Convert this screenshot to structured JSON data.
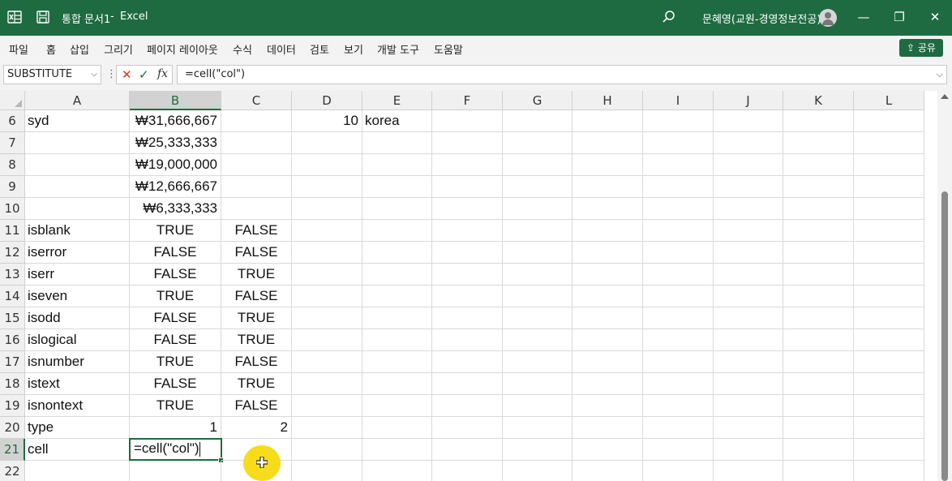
{
  "titlebar": {
    "filename": "통합 문서1",
    "separator": "-",
    "app": "Excel",
    "user": "문혜영(교원-경영정보전공)",
    "icons": [
      "excel-logo-icon",
      "save-icon",
      "search-icon",
      "avatar",
      "minimize-icon",
      "restore-icon",
      "close-icon"
    ],
    "colors": {
      "bar": "#1e6b41",
      "text": "#ffffff"
    }
  },
  "menu": {
    "items": [
      "파일",
      "홈",
      "삽입",
      "그리기",
      "페이지 레이아웃",
      "수식",
      "데이터",
      "검토",
      "보기",
      "개발 도구",
      "도움말"
    ],
    "share_label": "공유"
  },
  "formula_bar": {
    "name_box": "SUBSTITUTE",
    "separator": "⋮",
    "cancel_icon": "✕",
    "enter_icon": "✓",
    "fx_label": "fx",
    "formula": "=cell(\"col\")"
  },
  "columns": [
    "A",
    "B",
    "C",
    "D",
    "E",
    "F",
    "G",
    "H",
    "I",
    "J",
    "K",
    "L"
  ],
  "selected_column": "B",
  "selected_row": "21",
  "rows": [
    {
      "num": "6",
      "A": "syd",
      "B": "₩31,666,667",
      "C": "",
      "D": "10",
      "E": "korea"
    },
    {
      "num": "7",
      "A": "",
      "B": "₩25,333,333",
      "C": "",
      "D": "",
      "E": ""
    },
    {
      "num": "8",
      "A": "",
      "B": "₩19,000,000",
      "C": "",
      "D": "",
      "E": ""
    },
    {
      "num": "9",
      "A": "",
      "B": "₩12,666,667",
      "C": "",
      "D": "",
      "E": ""
    },
    {
      "num": "10",
      "A": "",
      "B": "₩6,333,333",
      "C": "",
      "D": "",
      "E": ""
    },
    {
      "num": "11",
      "A": "isblank",
      "B": "TRUE",
      "C": "FALSE",
      "D": "",
      "E": ""
    },
    {
      "num": "12",
      "A": "iserror",
      "B": "FALSE",
      "C": "FALSE",
      "D": "",
      "E": ""
    },
    {
      "num": "13",
      "A": "iserr",
      "B": "FALSE",
      "C": "TRUE",
      "D": "",
      "E": ""
    },
    {
      "num": "14",
      "A": "iseven",
      "B": "TRUE",
      "C": "FALSE",
      "D": "",
      "E": ""
    },
    {
      "num": "15",
      "A": "isodd",
      "B": "FALSE",
      "C": "TRUE",
      "D": "",
      "E": ""
    },
    {
      "num": "16",
      "A": "islogical",
      "B": "FALSE",
      "C": "TRUE",
      "D": "",
      "E": ""
    },
    {
      "num": "17",
      "A": "isnumber",
      "B": "TRUE",
      "C": "FALSE",
      "D": "",
      "E": ""
    },
    {
      "num": "18",
      "A": "istext",
      "B": "FALSE",
      "C": "TRUE",
      "D": "",
      "E": ""
    },
    {
      "num": "19",
      "A": "isnontext",
      "B": "TRUE",
      "C": "FALSE",
      "D": "",
      "E": ""
    },
    {
      "num": "20",
      "A": "type",
      "B": "1",
      "C": "2",
      "D": "",
      "E": ""
    },
    {
      "num": "21",
      "A": "cell",
      "B": "=cell(\"col\")",
      "C": "",
      "D": "",
      "E": ""
    },
    {
      "num": "22",
      "A": "",
      "B": "",
      "C": "",
      "D": "",
      "E": ""
    }
  ]
}
